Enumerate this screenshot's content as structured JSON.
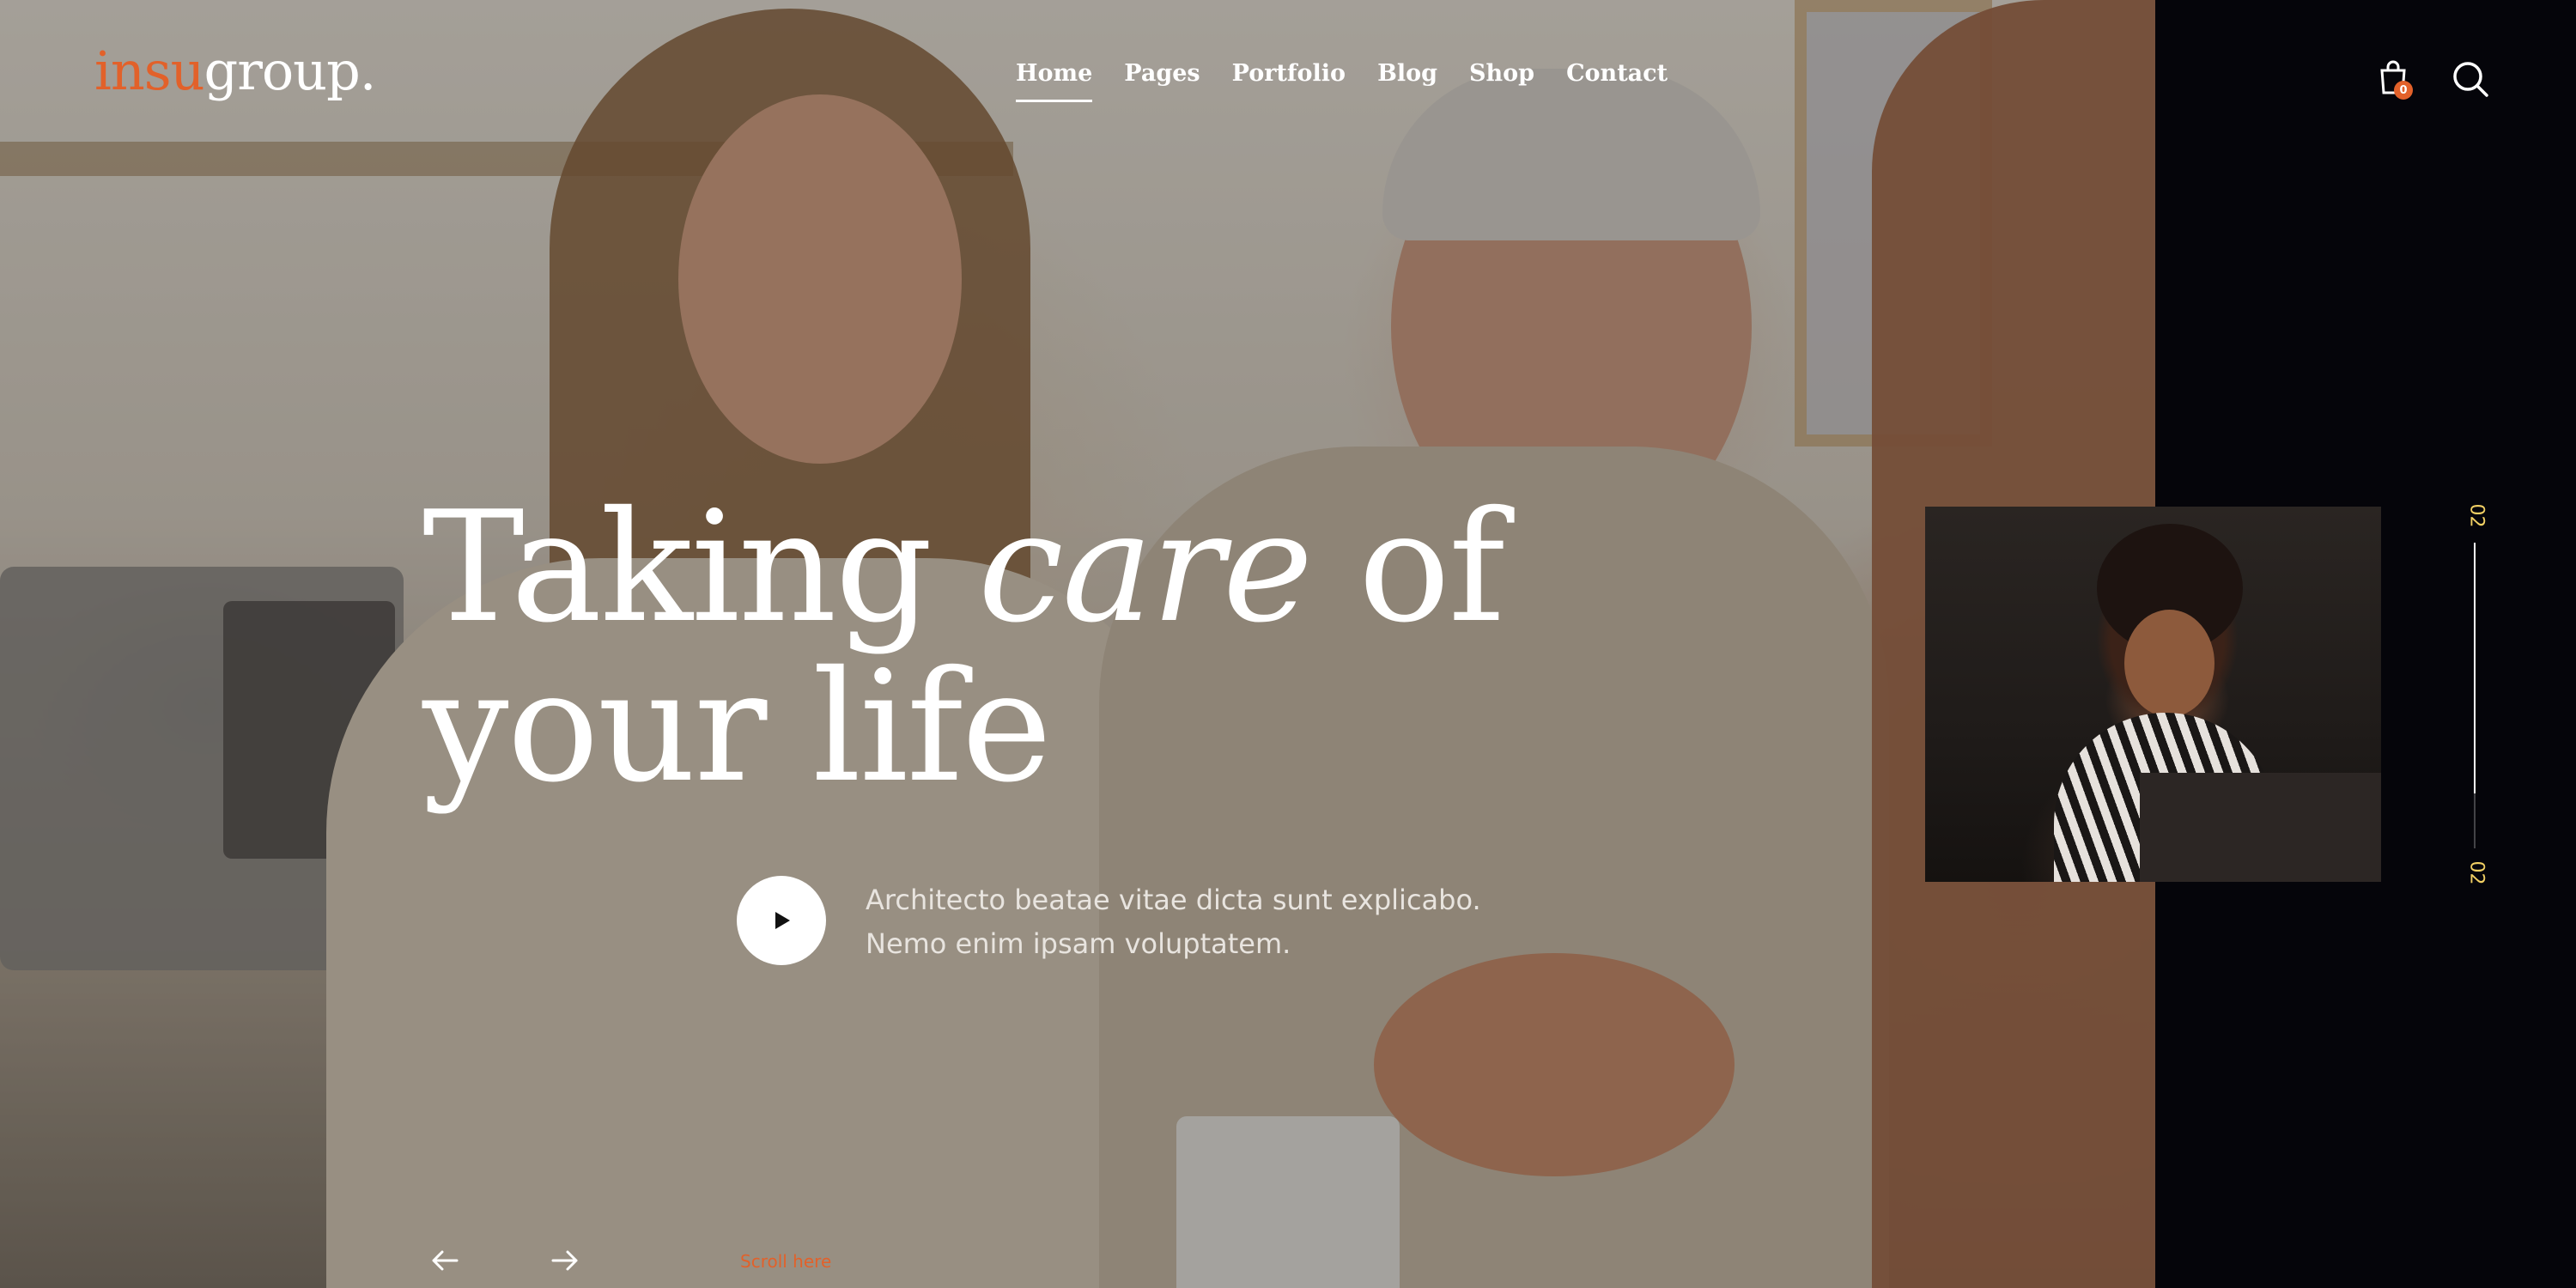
{
  "brand": {
    "logo_accent": "insu",
    "logo_rest": "group.",
    "accent_color": "#e2612a"
  },
  "nav": {
    "items": [
      {
        "label": "Home",
        "active": true
      },
      {
        "label": "Pages"
      },
      {
        "label": "Portfolio"
      },
      {
        "label": "Blog"
      },
      {
        "label": "Shop"
      },
      {
        "label": "Contact"
      }
    ]
  },
  "header_icons": {
    "cart_icon": "shopping-bag-icon",
    "cart_count": "0",
    "search_icon": "search-icon"
  },
  "hero": {
    "title_part1": "Taking",
    "title_italic": "care",
    "title_part2": "of",
    "title_line2": "your life",
    "description_line1": "Architecto beatae vitae dicta sunt explicabo.",
    "description_line2": "Nemo enim ipsam voluptatem.",
    "play_icon": "play-icon",
    "scroll_label": "Scroll here"
  },
  "slider": {
    "prev_icon": "arrow-left-icon",
    "next_icon": "arrow-right-icon",
    "current": "02",
    "total": "02",
    "progress": 1.0,
    "counter_color": "#f2d064"
  }
}
